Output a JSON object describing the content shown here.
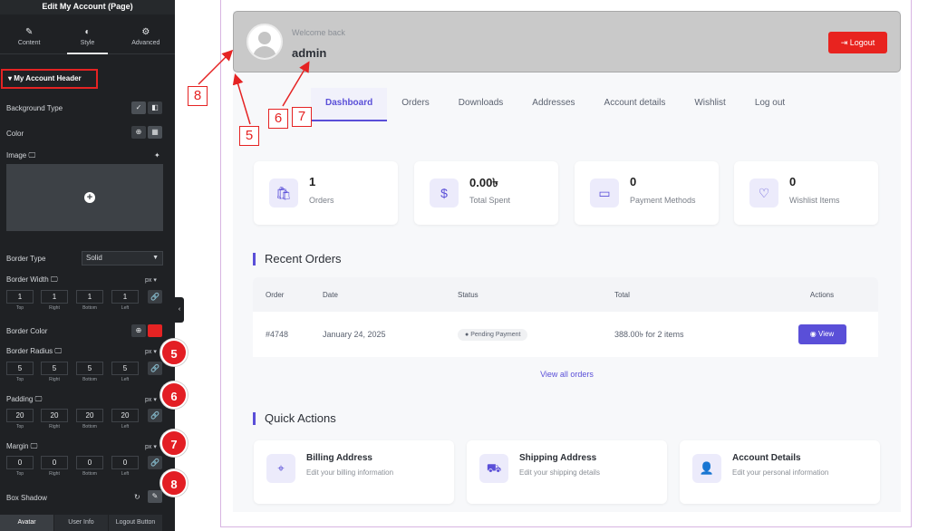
{
  "editor": {
    "title": "Edit My Account (Page)",
    "tabs": [
      {
        "label": "Content",
        "icon": "pencil-icon",
        "glyph": "✎"
      },
      {
        "label": "Style",
        "icon": "half-circle-icon",
        "glyph": "◐"
      },
      {
        "label": "Advanced",
        "icon": "gear-icon",
        "glyph": "⚙"
      }
    ],
    "section_title": "My Account Header",
    "background_type_label": "Background Type",
    "color_label": "Color",
    "image_label": "Image",
    "border_type_label": "Border Type",
    "border_type_value": "Solid",
    "border_width_label": "Border Width",
    "border_width_values": [
      "1",
      "1",
      "1",
      "1"
    ],
    "border_color_label": "Border Color",
    "border_color_swatch": "#e52323",
    "border_radius_label": "Border Radius",
    "border_radius_values": [
      "5",
      "5",
      "5",
      "5"
    ],
    "padding_label": "Padding",
    "padding_values": [
      "20",
      "20",
      "20",
      "20"
    ],
    "margin_label": "Margin",
    "margin_values": [
      "0",
      "0",
      "0",
      "0"
    ],
    "box_shadow_label": "Box Shadow",
    "unit": "px",
    "captions": [
      "Top",
      "Right",
      "Bottom",
      "Left"
    ],
    "bottom_tabs": [
      "Avatar",
      "User Info",
      "Logout Button"
    ],
    "markers": [
      "5",
      "6",
      "7",
      "8"
    ]
  },
  "account": {
    "welcome_text": "Welcome back",
    "username": "admin",
    "logout_label": "Logout",
    "nav": [
      "Dashboard",
      "Orders",
      "Downloads",
      "Addresses",
      "Account details",
      "Wishlist",
      "Log out"
    ],
    "stats": [
      {
        "value": "1",
        "label": "Orders",
        "icon": "bag-icon",
        "glyph": "🛍"
      },
      {
        "value": "0.00৳",
        "label": "Total Spent",
        "icon": "dollar-icon",
        "glyph": "$"
      },
      {
        "value": "0",
        "label": "Payment Methods",
        "icon": "credit-card-icon",
        "glyph": "▭"
      },
      {
        "value": "0",
        "label": "Wishlist Items",
        "icon": "heart-icon",
        "glyph": "♡"
      }
    ],
    "recent_orders_title": "Recent Orders",
    "orders_columns": [
      "Order",
      "Date",
      "Status",
      "Total",
      "Actions"
    ],
    "orders": [
      {
        "order": "#4748",
        "date": "January 24, 2025",
        "status": "Pending Payment",
        "total": "388.00৳  for 2 items",
        "action": "View"
      }
    ],
    "view_all": "View all orders",
    "quick_actions_title": "Quick Actions",
    "quick_actions": [
      {
        "title": "Billing Address",
        "desc": "Edit your billing information",
        "icon": "location-pin-icon",
        "glyph": "⌖"
      },
      {
        "title": "Shipping Address",
        "desc": "Edit your shipping details",
        "icon": "truck-icon",
        "glyph": "⛟"
      },
      {
        "title": "Account Details",
        "desc": "Edit your personal information",
        "icon": "user-icon",
        "glyph": "👤"
      }
    ]
  },
  "annotations": [
    "8",
    "5",
    "6",
    "7"
  ],
  "colors": {
    "accent": "#5a4fd8",
    "danger": "#e8231f",
    "header_bg": "#c9c9c9",
    "editor_bg": "#1f2124"
  }
}
